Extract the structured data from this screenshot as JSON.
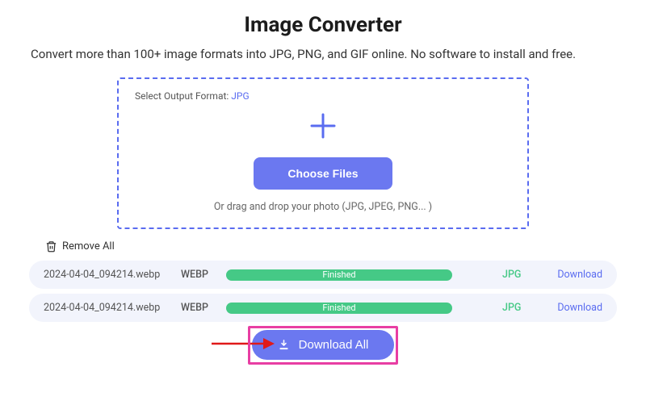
{
  "header": {
    "title": "Image Converter",
    "subtitle": "Convert more than 100+ image formats into JPG, PNG, and GIF online. No software to install and free."
  },
  "dropzone": {
    "output_label": "Select Output Format: ",
    "output_value": "JPG",
    "choose_files": "Choose Files",
    "drag_hint": "Or drag and drop your photo (JPG, JPEG, PNG... )"
  },
  "actions": {
    "remove_all": "Remove All",
    "download_all": "Download All"
  },
  "files": [
    {
      "name": "2024-04-04_094214.webp",
      "src_format": "WEBP",
      "status": "Finished",
      "dst_format": "JPG",
      "download": "Download"
    },
    {
      "name": "2024-04-04_094214.webp",
      "src_format": "WEBP",
      "status": "Finished",
      "dst_format": "JPG",
      "download": "Download"
    }
  ]
}
